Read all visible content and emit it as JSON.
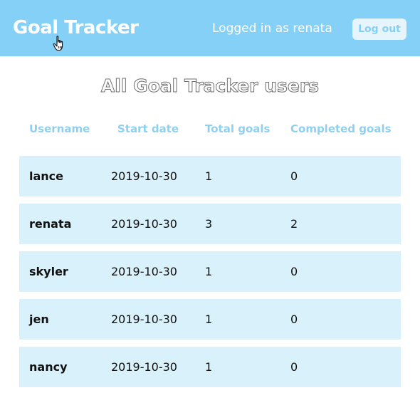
{
  "header": {
    "brand": "Goal Tracker",
    "login_status": "Logged in as renata",
    "logout_label": "Log out"
  },
  "main": {
    "title": "All Goal Tracker users",
    "columns": {
      "username": "Username",
      "start_date": "Start date",
      "total_goals": "Total goals",
      "completed_goals": "Completed goals"
    },
    "users": [
      {
        "username": "lance",
        "start_date": "2019-10-30",
        "total_goals": "1",
        "completed_goals": "0"
      },
      {
        "username": "renata",
        "start_date": "2019-10-30",
        "total_goals": "3",
        "completed_goals": "2"
      },
      {
        "username": "skyler",
        "start_date": "2019-10-30",
        "total_goals": "1",
        "completed_goals": "0"
      },
      {
        "username": "jen",
        "start_date": "2019-10-30",
        "total_goals": "1",
        "completed_goals": "0"
      },
      {
        "username": "nancy",
        "start_date": "2019-10-30",
        "total_goals": "1",
        "completed_goals": "0"
      }
    ]
  },
  "colors": {
    "header_bg": "#85d0f7",
    "row_bg": "#d9f1fb",
    "column_header": "#8fd0ee",
    "logout_bg": "#e6f4fb"
  },
  "icons": {
    "cursor": "hand-pointer-icon"
  }
}
